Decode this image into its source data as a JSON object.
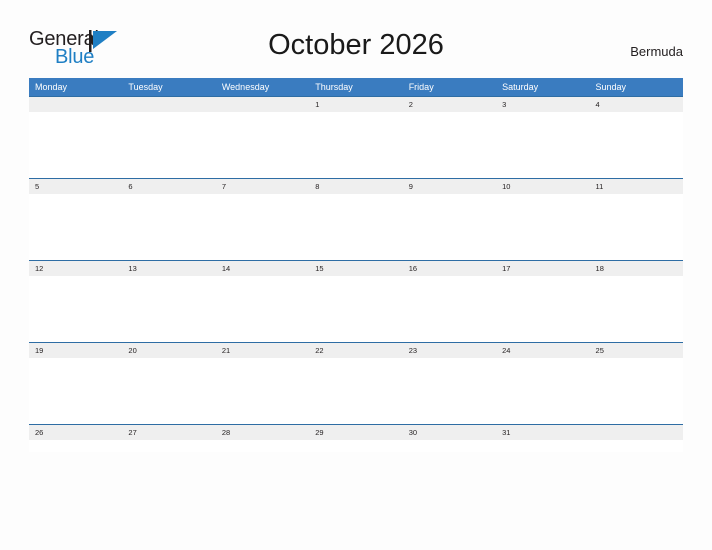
{
  "brand": {
    "name_part1": "General",
    "name_part2": "Blue",
    "logo_icon": "flag-triangle-icon",
    "color_primary": "#1f7fc4",
    "color_dark": "#231f20"
  },
  "header": {
    "title": "October 2026",
    "region": "Bermuda"
  },
  "calendar": {
    "header_color": "#3a7cc0",
    "date_band_color": "#efefef",
    "rule_color": "#2e6da4",
    "weekdays": [
      "Monday",
      "Tuesday",
      "Wednesday",
      "Thursday",
      "Friday",
      "Saturday",
      "Sunday"
    ],
    "weeks": [
      {
        "days": [
          "",
          "",
          "",
          "1",
          "2",
          "3",
          "4"
        ]
      },
      {
        "days": [
          "5",
          "6",
          "7",
          "8",
          "9",
          "10",
          "11"
        ]
      },
      {
        "days": [
          "12",
          "13",
          "14",
          "15",
          "16",
          "17",
          "18"
        ]
      },
      {
        "days": [
          "19",
          "20",
          "21",
          "22",
          "23",
          "24",
          "25"
        ]
      },
      {
        "days": [
          "26",
          "27",
          "28",
          "29",
          "30",
          "31",
          ""
        ]
      }
    ]
  }
}
